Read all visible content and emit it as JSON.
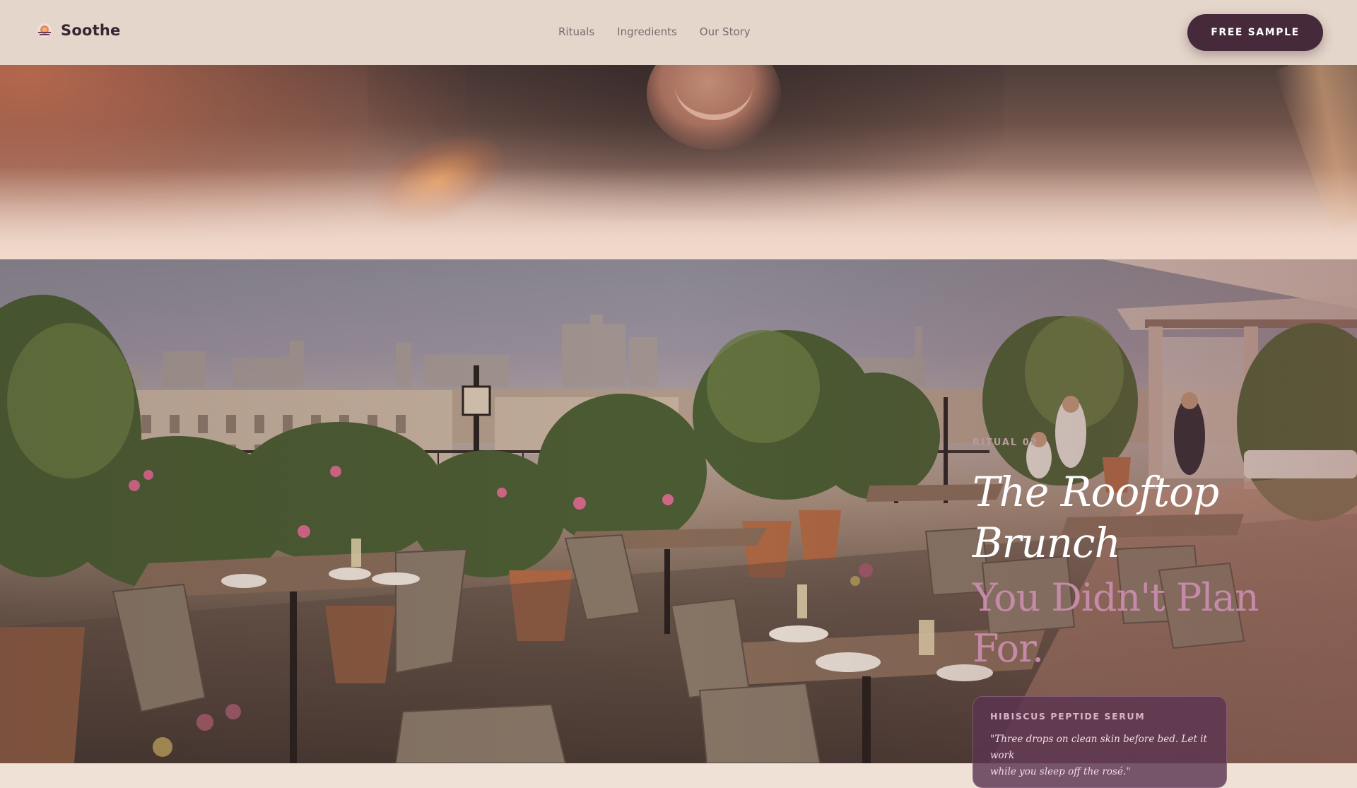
{
  "brand": {
    "name": "Soothe",
    "logo_icon": "sunrise-icon"
  },
  "nav": {
    "links": [
      {
        "label": "Rituals"
      },
      {
        "label": "Ingredients"
      },
      {
        "label": "Our Story"
      }
    ],
    "cta_label": "FREE SAMPLE"
  },
  "hero": {
    "kicker": "RITUAL 02",
    "title_line1": "The Rooftop",
    "title_line2": "Brunch",
    "subtitle_line1": "You Didn't Plan",
    "subtitle_line2": "For.",
    "card": {
      "title": "HIBISCUS PEPTIDE SERUM",
      "quote_line1": "\"Three drops on clean skin before bed. Let it work",
      "quote_line2": "while you sleep off the rosé.\""
    }
  },
  "colors": {
    "accent": "#46293a",
    "title": "#ffffff",
    "subtitle": "#c48aa7",
    "nav_bg": "#e4d6ca",
    "card_bg": "#5c3450"
  }
}
